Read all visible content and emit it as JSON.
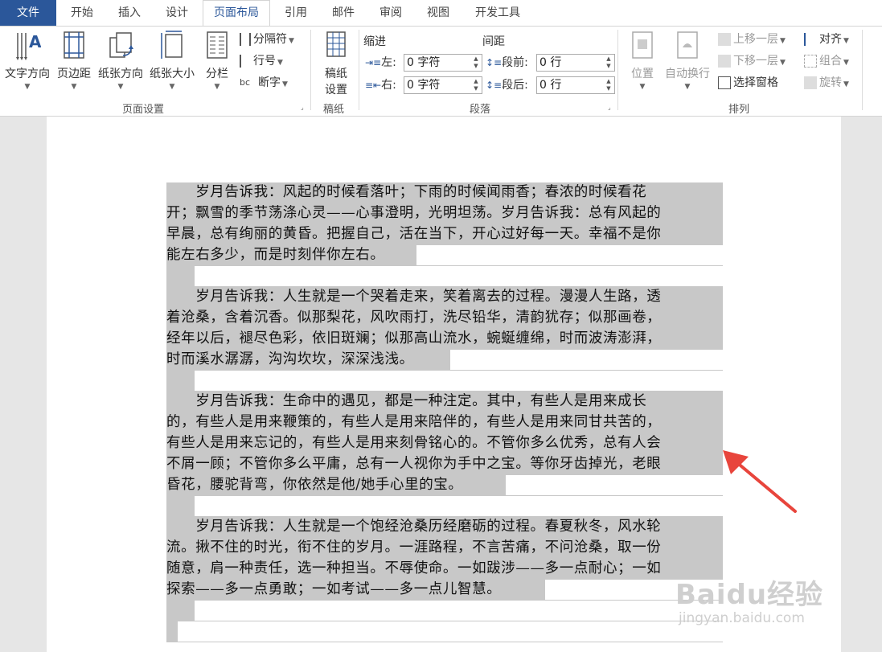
{
  "tabs": [
    {
      "label": "文件"
    },
    {
      "label": "开始"
    },
    {
      "label": "插入"
    },
    {
      "label": "设计"
    },
    {
      "label": "页面布局"
    },
    {
      "label": "引用"
    },
    {
      "label": "邮件"
    },
    {
      "label": "审阅"
    },
    {
      "label": "视图"
    },
    {
      "label": "开发工具"
    }
  ],
  "ribbon": {
    "page_setup": {
      "group_label": "页面设置",
      "text_direction": "文字方向",
      "margins": "页边距",
      "orientation": "纸张方向",
      "size": "纸张大小",
      "columns": "分栏",
      "breaks": "分隔符",
      "line_numbers": "行号",
      "hyphenation": "断字"
    },
    "manuscript": {
      "group_label": "稿纸",
      "button_line1": "稿纸",
      "button_line2": "设置"
    },
    "paragraph": {
      "group_label": "段落",
      "indent_title": "缩进",
      "spacing_title": "间距",
      "left_label": "左:",
      "left_value": "0 字符",
      "right_label": "右:",
      "right_value": "0 字符",
      "before_label": "段前:",
      "before_value": "0 行",
      "after_label": "段后:",
      "after_value": "0 行"
    },
    "arrange": {
      "group_label": "排列",
      "position": "位置",
      "wrap_text": "自动换行",
      "bring_forward": "上移一层",
      "send_backward": "下移一层",
      "selection_pane": "选择窗格",
      "align": "对齐",
      "group": "组合",
      "rotate": "旋转"
    }
  },
  "document": {
    "lines": [
      "　　岁月告诉我：风起的时候看落叶；下雨的时候闻雨香；春浓的时候看花",
      "开；飘雪的季节荡涤心灵——心事澄明，光明坦荡。岁月告诉我：总有风起的",
      "早晨，总有绚丽的黄昏。把握自己，活在当下，开心过好每一天。幸福不是你",
      "能左右多少，而是时刻伴你左右。",
      "",
      "　　岁月告诉我：人生就是一个哭着走来，笑着离去的过程。漫漫人生路，透",
      "着沧桑，含着沉香。似那梨花，风吹雨打，洗尽铅华，清韵犹存；似那画卷，",
      "经年以后，褪尽色彩，依旧斑斓；似那高山流水，蜿蜒缠绵，时而波涛澎湃，",
      "时而溪水潺潺，沟沟坎坎，深深浅浅。",
      "",
      "　　岁月告诉我：生命中的遇见，都是一种注定。其中，有些人是用来成长",
      "的，有些人是用来鞭策的，有些人是用来陪伴的，有些人是用来同甘共苦的，",
      "有些人是用来忘记的，有些人是用来刻骨铭心的。不管你多么优秀，总有人会",
      "不屑一顾；不管你多么平庸，总有一人视你为手中之宝。等你牙齿掉光，老眼",
      "昏花，腰驼背弯，你依然是他/她手心里的宝。",
      "",
      "　　岁月告诉我：人生就是一个饱经沧桑历经磨砺的过程。春夏秋冬，风水轮",
      "流。揪不住的时光，衔不住的岁月。一涯路程，不言苦痛，不问沧桑，取一份",
      "随意，肩一种责任，选一种担当。不辱使命。一如跋涉——多一点耐心；一如",
      "探索——多一点勇敢；一如考试——多一点儿智慧。",
      "",
      ""
    ],
    "highlight_fraction": [
      1,
      1,
      1,
      0.45,
      0.05,
      1,
      1,
      1,
      0.51,
      0.05,
      1,
      1,
      1,
      1,
      0.61,
      0.05,
      1,
      1,
      1,
      0.68,
      0.05,
      0.02
    ]
  },
  "watermark": {
    "brand": "Baidu经验",
    "url": "jingyan.baidu.com"
  },
  "colors": {
    "file_tab": "#2b579a",
    "highlight": "#c8c8c8",
    "arrow": "#e8453c"
  }
}
